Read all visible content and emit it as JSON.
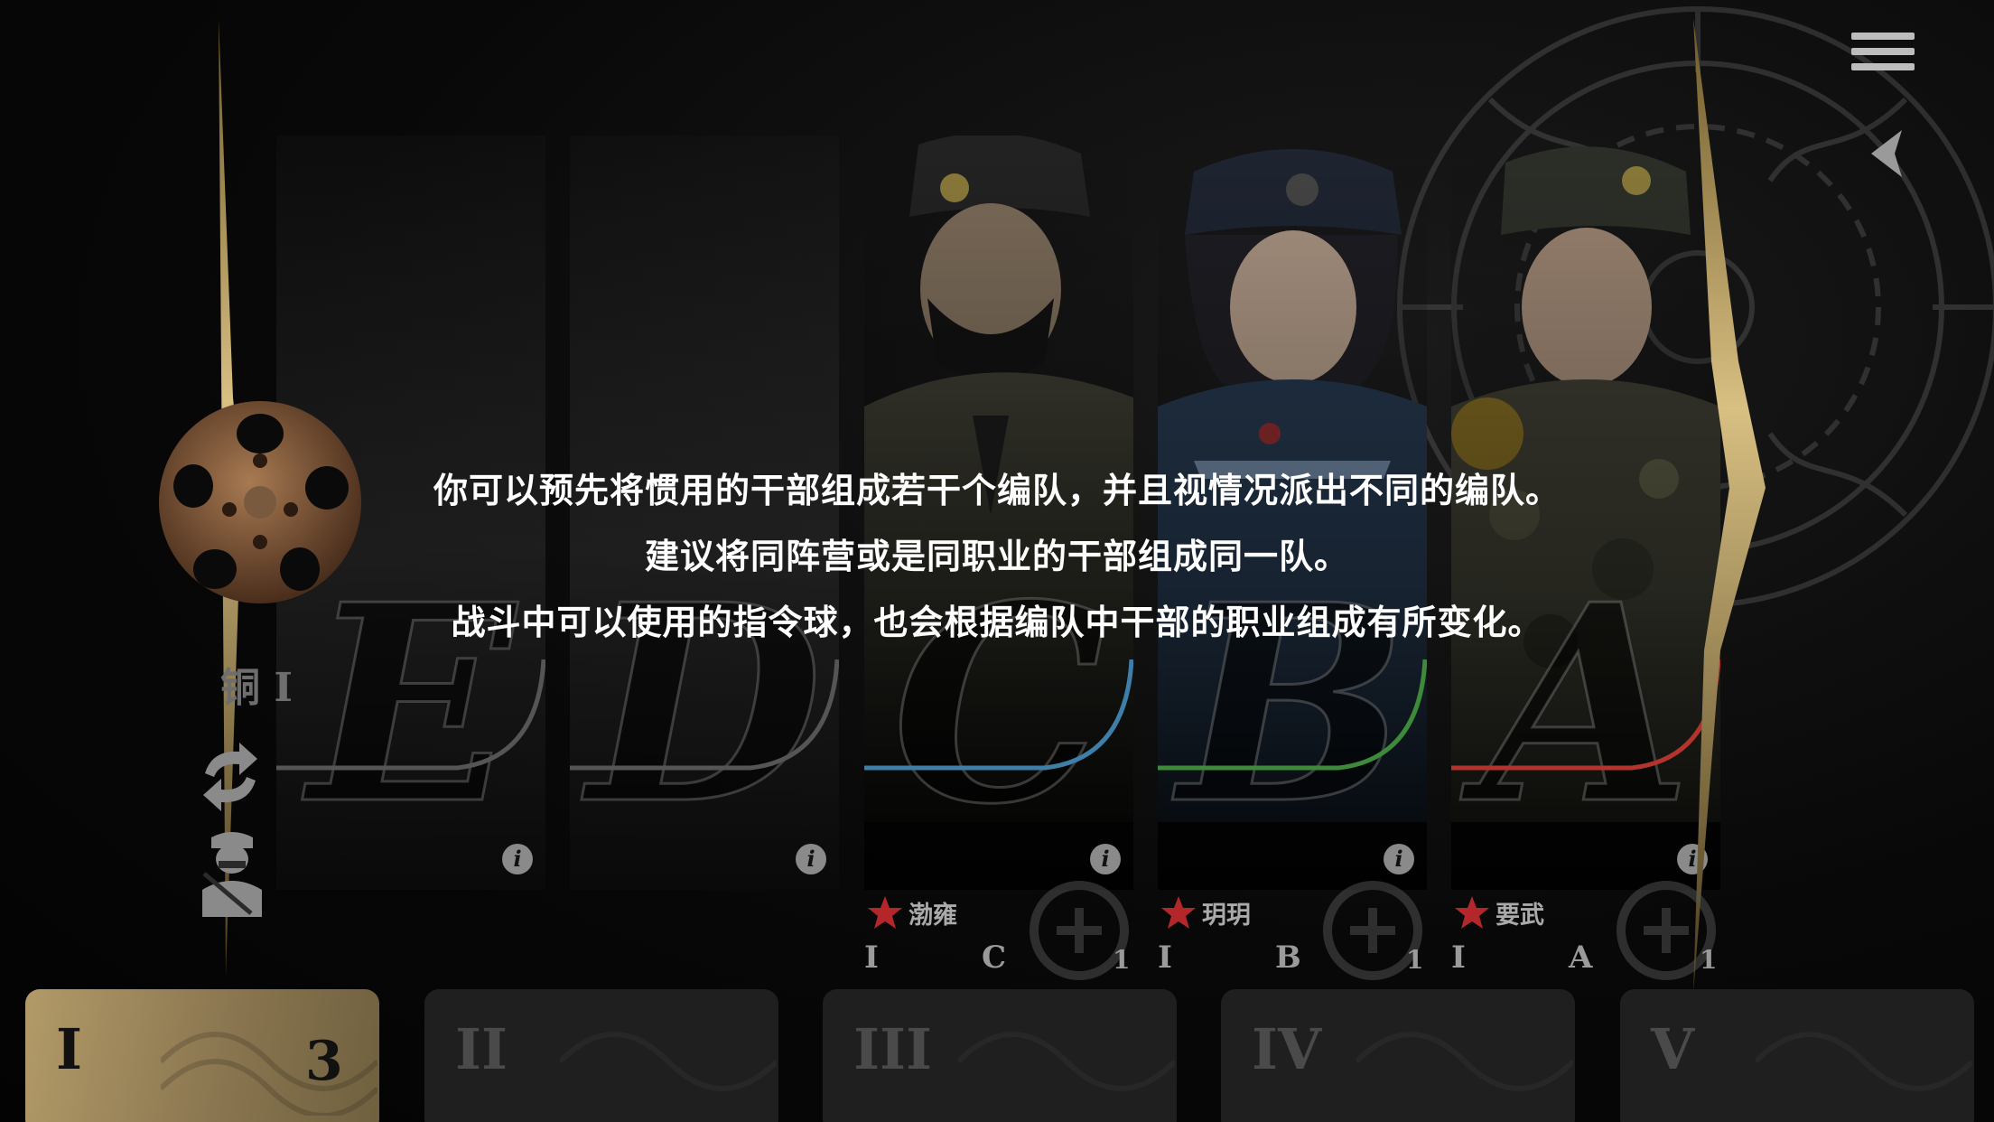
{
  "rank": {
    "label": "铜 I"
  },
  "message": {
    "line1": "你可以预先将惯用的干部组成若干个编队，并且视情况派出不同的编队。",
    "line2": "建议将同阵营或是同职业的干部组成同一队。",
    "line3": "战斗中可以使用的指令球，也会根据编队中干部的职业组成有所变化。"
  },
  "slots": [
    {
      "letter": "E",
      "info": "i"
    },
    {
      "letter": "D",
      "info": "i"
    },
    {
      "letter": "C",
      "info": "i",
      "name": "渤雍",
      "stats": [
        "I",
        "C",
        "1"
      ],
      "accent": "#3d7fa8"
    },
    {
      "letter": "B",
      "info": "i",
      "name": "玥玥",
      "stats": [
        "I",
        "B",
        "1"
      ],
      "accent": "#3c8a3a"
    },
    {
      "letter": "A",
      "info": "i",
      "name": "要武",
      "stats": [
        "I",
        "A",
        "1"
      ],
      "accent": "#b3342c"
    }
  ],
  "tabs": [
    {
      "roman": "I",
      "count": "3",
      "active": true
    },
    {
      "roman": "II"
    },
    {
      "roman": "III"
    },
    {
      "roman": "IV"
    },
    {
      "roman": "V"
    }
  ],
  "colors": {
    "gold": "#c8ad6e",
    "tab_active": "#b29a68",
    "tab_inactive": "#1f1f1f"
  }
}
